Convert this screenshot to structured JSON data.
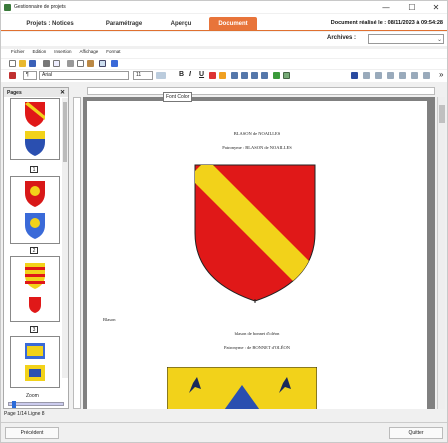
{
  "window": {
    "title": "Gestionnaire de projets",
    "minimize": "—",
    "maximize": "☐",
    "close": "✕"
  },
  "tabs": [
    {
      "label": "Projets : Notices"
    },
    {
      "label": "Paramétrage"
    },
    {
      "label": "Aperçu"
    },
    {
      "label": "Document"
    }
  ],
  "doc_date": "Document réalisé le : 08/11/2023 à 09:54:28",
  "archives": {
    "label": "Archives :",
    "value": ""
  },
  "menu": [
    "Fichier",
    "Edition",
    "Insertion",
    "Affichage",
    "Format"
  ],
  "format_bar": {
    "font_name": "Arial",
    "font_size": "11",
    "bold": "B",
    "italic": "I",
    "underline": "U"
  },
  "tooltip": "Font Color",
  "left_pane": {
    "title": "Pages",
    "close": "✕",
    "page_numbers": [
      "1",
      "2",
      "3"
    ],
    "zoom_label": "Zoom"
  },
  "page_status": "Page 1/14 Ligne 8",
  "document": {
    "heading1": "BLASON de NOAILLES",
    "patronyme1": "Patronyme : BLASON de NOAILLES",
    "blason_label": "Blason",
    "heading2": "blason de bonnet d'oléon",
    "patronyme2": "Patronyme : de BONNET d'OLÉON"
  },
  "buttons": {
    "previous": "Précédent",
    "quit": "Quitter"
  },
  "colors": {
    "accent": "#e8743a",
    "shield_red": "#e01818",
    "shield_yellow": "#f2d21a",
    "shield_blue": "#2a4fb0"
  }
}
